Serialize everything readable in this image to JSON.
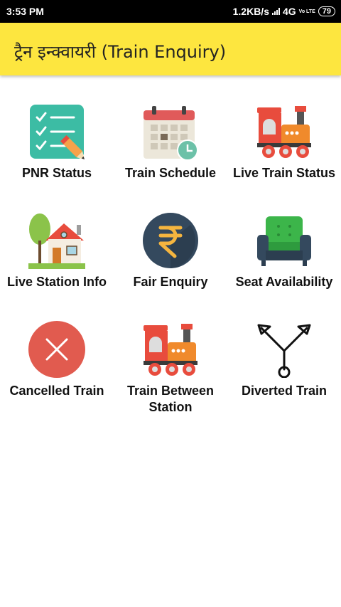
{
  "status_bar": {
    "time": "3:53 PM",
    "network_speed": "1.2KB/s",
    "network_type": "4G",
    "volte": "Vo LTE",
    "battery": "79"
  },
  "app_bar": {
    "title": "ट्रैन इन्क्वायरी (Train Enquiry)",
    "background_color": "#fde63f"
  },
  "menu": {
    "items": [
      {
        "label": "PNR Status",
        "icon": "checklist-icon"
      },
      {
        "label": "Train Schedule",
        "icon": "calendar-clock-icon"
      },
      {
        "label": "Live Train Status",
        "icon": "locomotive-icon"
      },
      {
        "label": "Live Station Info",
        "icon": "house-tree-icon"
      },
      {
        "label": "Fair Enquiry",
        "icon": "rupee-icon"
      },
      {
        "label": "Seat Availability",
        "icon": "armchair-icon"
      },
      {
        "label": "Cancelled Train",
        "icon": "cancel-icon"
      },
      {
        "label": "Train Between Station",
        "icon": "locomotive-icon"
      },
      {
        "label": "Diverted Train",
        "icon": "diverge-arrows-icon"
      }
    ]
  }
}
